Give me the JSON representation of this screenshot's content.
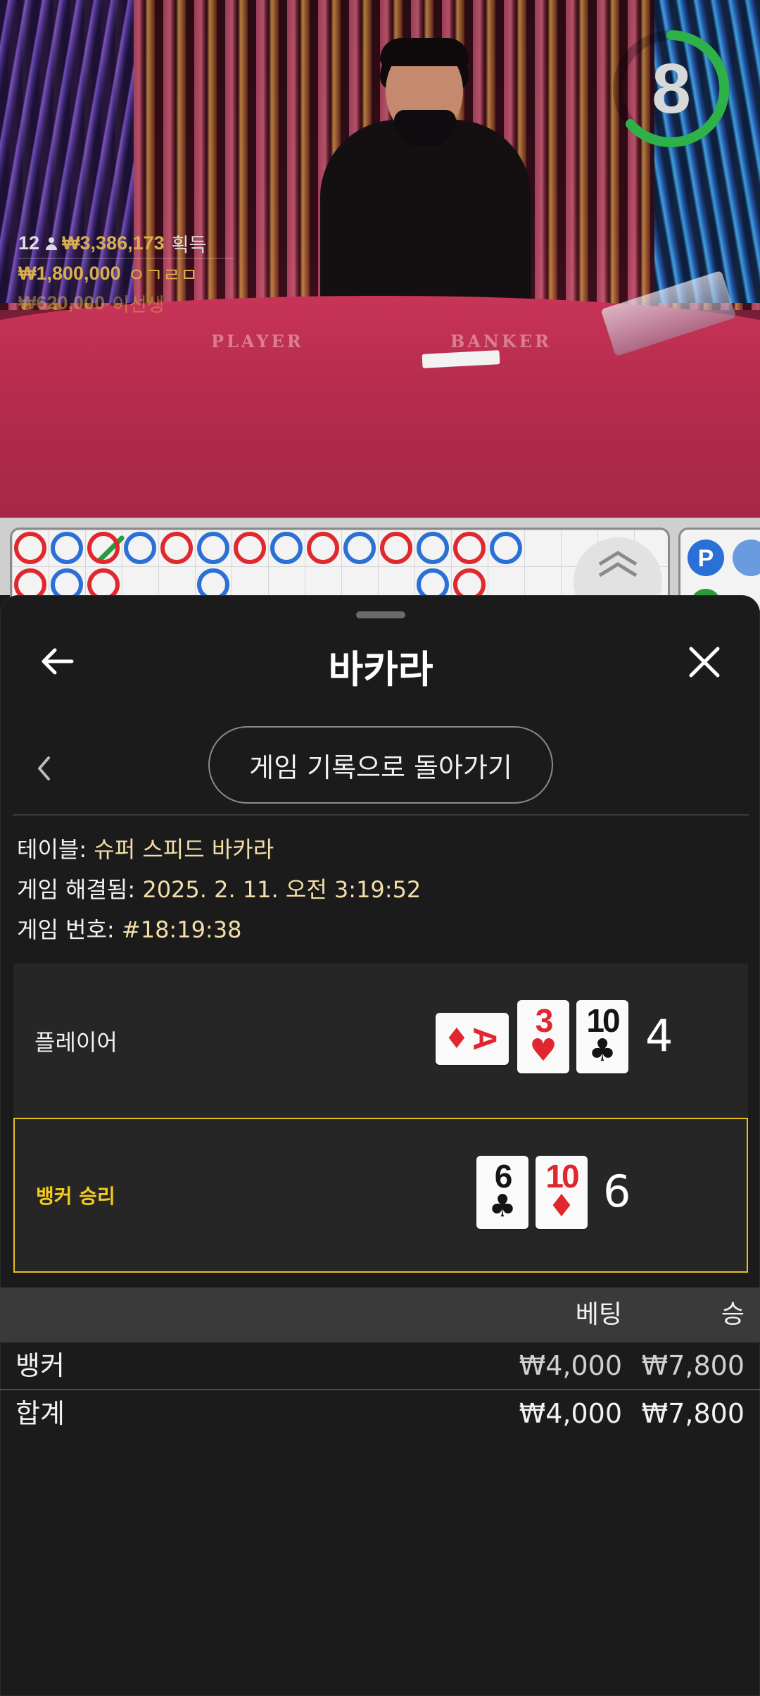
{
  "video": {
    "timer": "8",
    "winners": {
      "count": "12",
      "total_win": "₩3,386,173",
      "total_label": "획득",
      "top": [
        {
          "amount": "₩1,800,000",
          "name": "ㅇㄱㄹㅁ"
        },
        {
          "amount": "₩620,000",
          "name": "이선생"
        }
      ]
    },
    "table_labels": {
      "player": "PLAYER",
      "banker": "BANKER"
    }
  },
  "sheet": {
    "title": "바카라",
    "back_to_history": "게임 기록으로 돌아가기",
    "info": {
      "table_label": "테이블:",
      "table_value": "슈퍼 스피드 바카라",
      "resolved_label": "게임 해결됨:",
      "resolved_value": "2025. 2. 11. 오전 3:19:52",
      "game_no_label": "게임 번호:",
      "game_no_value": "#18:19:38"
    },
    "player": {
      "label": "플레이어",
      "total": "4",
      "cards": [
        {
          "rank": "A",
          "suit": "♦",
          "color": "red",
          "sideways": true
        },
        {
          "rank": "3",
          "suit": "♥",
          "color": "red",
          "sideways": false
        },
        {
          "rank": "10",
          "suit": "♣",
          "color": "black",
          "sideways": false
        }
      ]
    },
    "banker": {
      "label": "뱅커 승리",
      "total": "6",
      "cards": [
        {
          "rank": "6",
          "suit": "♣",
          "color": "black",
          "sideways": false
        },
        {
          "rank": "10",
          "suit": "♦",
          "color": "red",
          "sideways": false
        }
      ]
    },
    "bets": {
      "col_bet": "베팅",
      "col_win": "승",
      "rows": [
        {
          "name": "뱅커",
          "bet": "₩4,000",
          "win": "₩7,800"
        }
      ],
      "total": {
        "name": "합계",
        "bet": "₩4,000",
        "win": "₩7,800"
      }
    }
  },
  "colors": {
    "accent_gold": "#f2cc1a",
    "timer_green": "#2fb14a",
    "banker_red": "#e0282f",
    "player_blue": "#2a70d6"
  },
  "road": {
    "beads": [
      {
        "col": 0,
        "row": 0,
        "t": "b"
      },
      {
        "col": 1,
        "row": 0,
        "t": "p"
      },
      {
        "col": 2,
        "row": 0,
        "t": "b"
      },
      {
        "col": 3,
        "row": 0,
        "t": "p"
      },
      {
        "col": 4,
        "row": 0,
        "t": "b"
      },
      {
        "col": 5,
        "row": 0,
        "t": "p"
      },
      {
        "col": 6,
        "row": 0,
        "t": "b"
      },
      {
        "col": 7,
        "row": 0,
        "t": "p"
      },
      {
        "col": 8,
        "row": 0,
        "t": "b"
      },
      {
        "col": 9,
        "row": 0,
        "t": "p"
      },
      {
        "col": 10,
        "row": 0,
        "t": "b"
      },
      {
        "col": 11,
        "row": 0,
        "t": "p"
      },
      {
        "col": 12,
        "row": 0,
        "t": "b"
      },
      {
        "col": 13,
        "row": 0,
        "t": "p"
      },
      {
        "col": 0,
        "row": 1,
        "t": "b"
      },
      {
        "col": 1,
        "row": 1,
        "t": "p"
      },
      {
        "col": 2,
        "row": 1,
        "t": "b"
      },
      {
        "col": 5,
        "row": 1,
        "t": "p"
      },
      {
        "col": 11,
        "row": 1,
        "t": "p"
      },
      {
        "col": 12,
        "row": 1,
        "t": "b"
      }
    ]
  }
}
